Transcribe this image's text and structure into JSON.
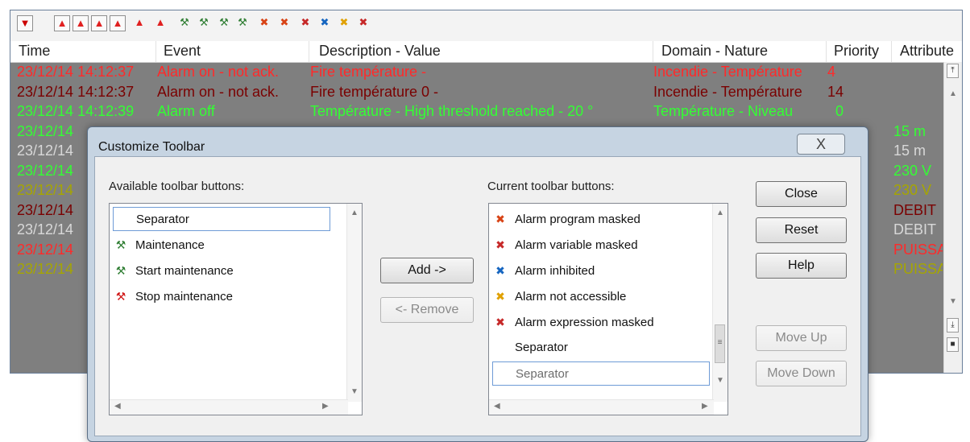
{
  "toolbar": {
    "icons": [
      "dropdown-arrow-icon",
      "alarm-bell-icon",
      "alarm-bell-icon",
      "alarm-bell-icon",
      "alarm-bell-icon",
      "alarm-bell-icon",
      "alarm-bell-icon",
      "maintenance-icon",
      "maintenance-icon",
      "maintenance-icon",
      "maintenance-icon",
      "program-masked-icon",
      "program-masked-icon",
      "variable-masked-icon",
      "inhibited-icon",
      "not-accessible-icon",
      "expression-masked-icon"
    ]
  },
  "columns": {
    "time": "Time",
    "event": "Event",
    "description": "Description - Value",
    "domain": "Domain - Nature",
    "priority": "Priority",
    "attribute": "Attribute"
  },
  "alarm_rows": [
    {
      "time": "23/12/14 14:12:37",
      "event": "Alarm on - not ack.",
      "description": "Fire température -",
      "domain": "Incendie - Température",
      "priority": "4",
      "attribute": "",
      "color": "#ff2a2a"
    },
    {
      "time": "23/12/14 14:12:37",
      "event": "Alarm on - not ack.",
      "description": "Fire température 0 -",
      "domain": "Incendie - Température",
      "priority": "14",
      "attribute": "",
      "color": "#7a0000"
    },
    {
      "time": "23/12/14 14:12:39",
      "event": "Alarm off",
      "description": "Température - High threshold reached -   20 °",
      "domain": "Température - Niveau",
      "priority": "0",
      "attribute": "",
      "color": "#33ff33"
    },
    {
      "time": "23/12/14",
      "event": "",
      "description": "",
      "domain": "",
      "priority": "",
      "attribute": "15 m",
      "color": "#33ff33"
    },
    {
      "time": "23/12/14",
      "event": "",
      "description": "",
      "domain": "",
      "priority": "",
      "attribute": "15 m",
      "color": "#d8d8d8"
    },
    {
      "time": "23/12/14",
      "event": "",
      "description": "",
      "domain": "",
      "priority": "",
      "attribute": "230 V",
      "color": "#33ff33"
    },
    {
      "time": "23/12/14",
      "event": "",
      "description": "",
      "domain": "",
      "priority": "",
      "attribute": "230 V",
      "color": "#a6a600"
    },
    {
      "time": "23/12/14",
      "event": "",
      "description": "",
      "domain": "",
      "priority": "",
      "attribute": "DEBIT",
      "color": "#7a0000"
    },
    {
      "time": "23/12/14",
      "event": "",
      "description": "",
      "domain": "",
      "priority": "",
      "attribute": "DEBIT",
      "color": "#d8d8d8"
    },
    {
      "time": "23/12/14",
      "event": "",
      "description": "",
      "domain": "",
      "priority": "",
      "attribute": "PUISSA",
      "color": "#ff2a2a"
    },
    {
      "time": "23/12/14",
      "event": "",
      "description": "",
      "domain": "",
      "priority": "",
      "attribute": "PUISSA",
      "color": "#a6a600"
    }
  ],
  "dialog": {
    "title": "Customize Toolbar",
    "close_glyph": "X",
    "available_label": "Available toolbar buttons:",
    "current_label": "Current toolbar buttons:",
    "available_items": [
      {
        "label": "Separator",
        "icon": "",
        "selected": true
      },
      {
        "label": "Maintenance",
        "icon": "maintenance-icon",
        "selected": false
      },
      {
        "label": "Start maintenance",
        "icon": "start-maintenance-icon",
        "selected": false
      },
      {
        "label": "Stop maintenance",
        "icon": "stop-maintenance-icon",
        "selected": false
      }
    ],
    "current_items": [
      {
        "label": "Alarm program masked",
        "icon": "program-masked-icon",
        "selected": false
      },
      {
        "label": "Alarm variable masked",
        "icon": "variable-masked-icon",
        "selected": false
      },
      {
        "label": "Alarm inhibited",
        "icon": "inhibited-icon",
        "selected": false
      },
      {
        "label": "Alarm not accessible",
        "icon": "not-accessible-icon",
        "selected": false
      },
      {
        "label": "Alarm expression masked",
        "icon": "expression-masked-icon",
        "selected": false
      },
      {
        "label": "Separator",
        "icon": "",
        "selected": false
      },
      {
        "label": "Separator",
        "icon": "",
        "selected": true
      }
    ],
    "buttons": {
      "add": "Add ->",
      "remove": "<- Remove",
      "close": "Close",
      "reset": "Reset",
      "help": "Help",
      "move_up": "Move Up",
      "move_down": "Move Down"
    }
  }
}
